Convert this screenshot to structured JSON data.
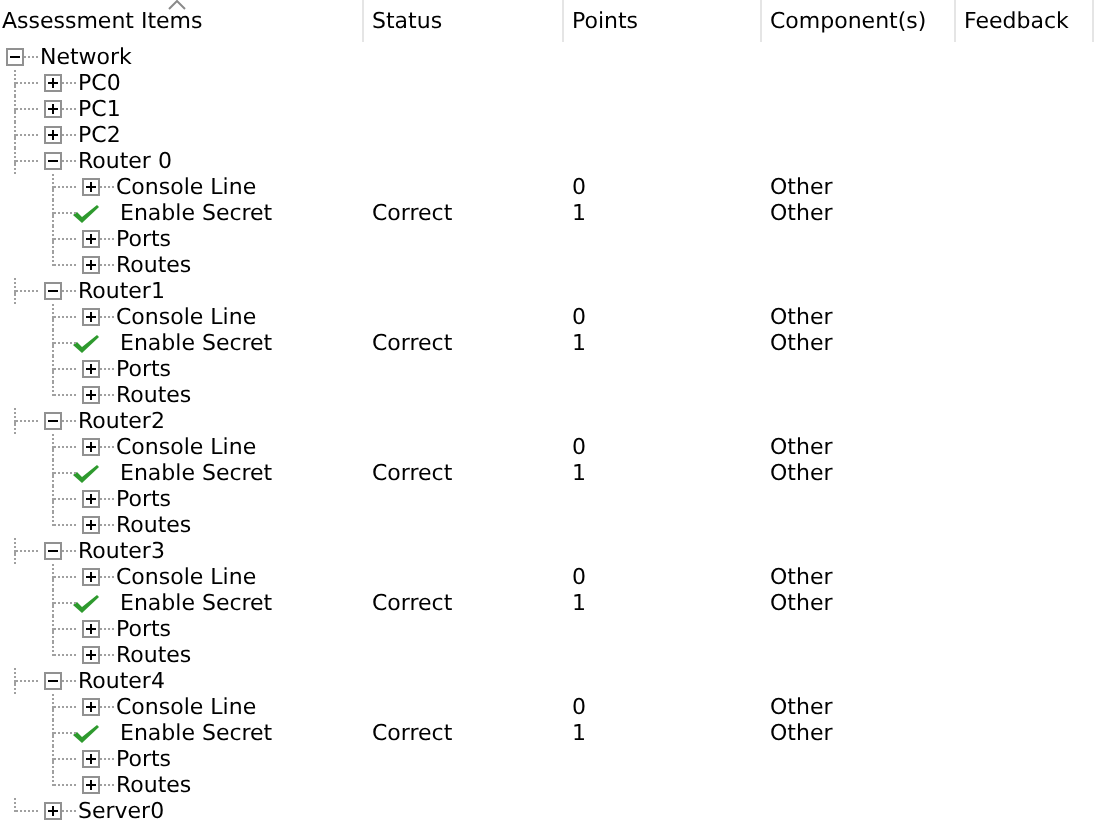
{
  "columns": [
    {
      "label": "Assessment Items",
      "sorted": true
    },
    {
      "label": "Status",
      "sorted": false
    },
    {
      "label": "Points",
      "sorted": false
    },
    {
      "label": "Component(s)",
      "sorted": false
    },
    {
      "label": "Feedback",
      "sorted": false
    }
  ],
  "tree": [
    {
      "label": "Network",
      "kind": "group",
      "expanded": true,
      "children": [
        {
          "label": "PC0",
          "kind": "group",
          "expanded": false
        },
        {
          "label": "PC1",
          "kind": "group",
          "expanded": false
        },
        {
          "label": "PC2",
          "kind": "group",
          "expanded": false
        },
        {
          "label": "Router 0",
          "kind": "group",
          "expanded": true,
          "children": [
            {
              "label": "Console Line",
              "kind": "group",
              "expanded": false,
              "points": "0",
              "component": "Other"
            },
            {
              "label": "Enable Secret",
              "kind": "check",
              "status": "Correct",
              "points": "1",
              "component": "Other"
            },
            {
              "label": "Ports",
              "kind": "group",
              "expanded": false
            },
            {
              "label": "Routes",
              "kind": "group",
              "expanded": false
            }
          ]
        },
        {
          "label": "Router1",
          "kind": "group",
          "expanded": true,
          "children": [
            {
              "label": "Console Line",
              "kind": "group",
              "expanded": false,
              "points": "0",
              "component": "Other"
            },
            {
              "label": "Enable Secret",
              "kind": "check",
              "status": "Correct",
              "points": "1",
              "component": "Other"
            },
            {
              "label": "Ports",
              "kind": "group",
              "expanded": false
            },
            {
              "label": "Routes",
              "kind": "group",
              "expanded": false
            }
          ]
        },
        {
          "label": "Router2",
          "kind": "group",
          "expanded": true,
          "children": [
            {
              "label": "Console Line",
              "kind": "group",
              "expanded": false,
              "points": "0",
              "component": "Other"
            },
            {
              "label": "Enable Secret",
              "kind": "check",
              "status": "Correct",
              "points": "1",
              "component": "Other"
            },
            {
              "label": "Ports",
              "kind": "group",
              "expanded": false
            },
            {
              "label": "Routes",
              "kind": "group",
              "expanded": false
            }
          ]
        },
        {
          "label": "Router3",
          "kind": "group",
          "expanded": true,
          "children": [
            {
              "label": "Console Line",
              "kind": "group",
              "expanded": false,
              "points": "0",
              "component": "Other"
            },
            {
              "label": "Enable Secret",
              "kind": "check",
              "status": "Correct",
              "points": "1",
              "component": "Other"
            },
            {
              "label": "Ports",
              "kind": "group",
              "expanded": false
            },
            {
              "label": "Routes",
              "kind": "group",
              "expanded": false
            }
          ]
        },
        {
          "label": "Router4",
          "kind": "group",
          "expanded": true,
          "children": [
            {
              "label": "Console Line",
              "kind": "group",
              "expanded": false,
              "points": "0",
              "component": "Other"
            },
            {
              "label": "Enable Secret",
              "kind": "check",
              "status": "Correct",
              "points": "1",
              "component": "Other"
            },
            {
              "label": "Ports",
              "kind": "group",
              "expanded": false
            },
            {
              "label": "Routes",
              "kind": "group",
              "expanded": false
            }
          ]
        },
        {
          "label": "Server0",
          "kind": "group",
          "expanded": false
        }
      ]
    }
  ]
}
